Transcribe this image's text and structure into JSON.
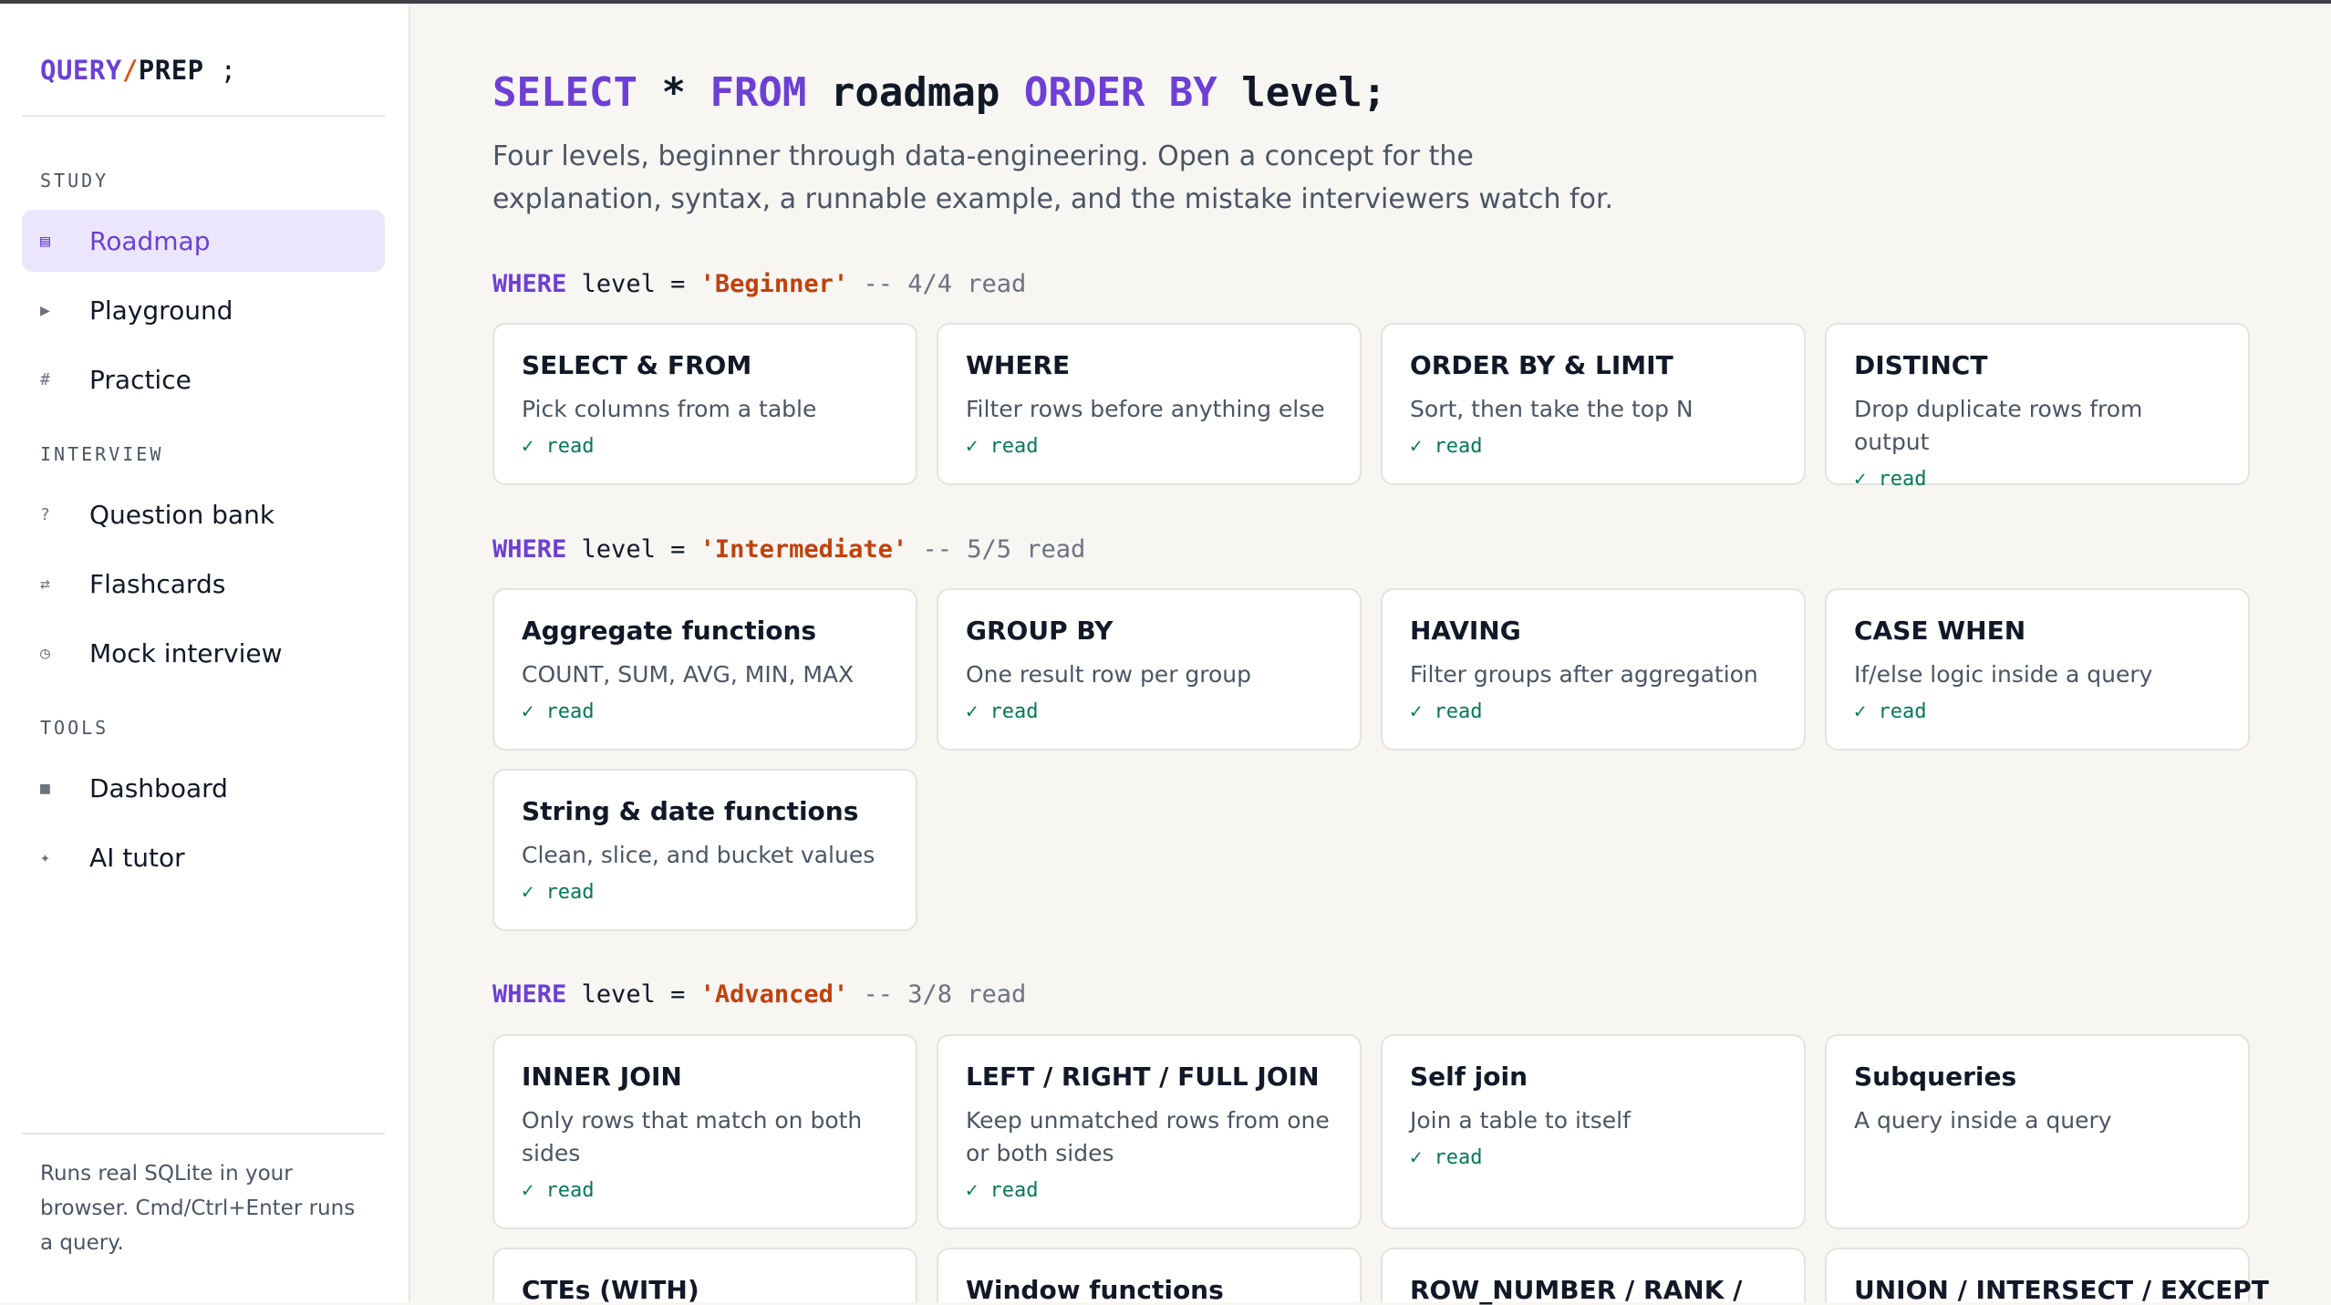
{
  "sidebar": {
    "logo": {
      "part1": "QUERY",
      "sep": "/",
      "part2": "PREP",
      "semi": ";"
    },
    "sections": [
      {
        "label": "STUDY",
        "items": [
          {
            "icon": "▤",
            "icon_name": "map-icon",
            "label": "Roadmap",
            "active": true
          },
          {
            "icon": "▶",
            "icon_name": "play-icon",
            "label": "Playground"
          },
          {
            "icon": "#",
            "icon_name": "hash-icon",
            "label": "Practice"
          }
        ]
      },
      {
        "label": "INTERVIEW",
        "items": [
          {
            "icon": "?",
            "icon_name": "question-icon",
            "label": "Question bank"
          },
          {
            "icon": "⇄",
            "icon_name": "swap-icon",
            "label": "Flashcards"
          },
          {
            "icon": "◷",
            "icon_name": "clock-icon",
            "label": "Mock interview"
          }
        ]
      },
      {
        "label": "TOOLS",
        "items": [
          {
            "icon": "■",
            "icon_name": "dashboard-icon",
            "label": "Dashboard"
          },
          {
            "icon": "✦",
            "icon_name": "sparkle-icon",
            "label": "AI tutor"
          }
        ]
      }
    ],
    "footer": "Runs real SQLite in your browser. Cmd/Ctrl+Enter runs a query."
  },
  "main": {
    "headline": {
      "kw1": "SELECT",
      "star": "*",
      "kw2": "FROM",
      "table": "roadmap",
      "kw3": "ORDER BY",
      "col": "level;"
    },
    "subtitle": "Four levels, beginner through data-engineering. Open a concept for the explanation, syntax, a runnable example, and the mistake interviewers watch for.",
    "levels": [
      {
        "where": "WHERE",
        "field": "level =",
        "value": "'Beginner'",
        "comment": "-- 4/4 read",
        "cards": [
          {
            "title": "SELECT & FROM",
            "desc": "Pick columns from a table",
            "status": "✓ read"
          },
          {
            "title": "WHERE",
            "desc": "Filter rows before anything else",
            "status": "✓ read"
          },
          {
            "title": "ORDER BY & LIMIT",
            "desc": "Sort, then take the top N",
            "status": "✓ read"
          },
          {
            "title": "DISTINCT",
            "desc": "Drop duplicate rows from output",
            "status": "✓ read"
          }
        ]
      },
      {
        "where": "WHERE",
        "field": "level =",
        "value": "'Intermediate'",
        "comment": "-- 5/5 read",
        "cards": [
          {
            "title": "Aggregate functions",
            "desc": "COUNT, SUM, AVG, MIN, MAX",
            "status": "✓ read"
          },
          {
            "title": "GROUP BY",
            "desc": "One result row per group",
            "status": "✓ read"
          },
          {
            "title": "HAVING",
            "desc": "Filter groups after aggregation",
            "status": "✓ read"
          },
          {
            "title": "CASE WHEN",
            "desc": "If/else logic inside a query",
            "status": "✓ read"
          },
          {
            "title": "String & date functions",
            "desc": "Clean, slice, and bucket values",
            "status": "✓ read"
          }
        ]
      },
      {
        "where": "WHERE",
        "field": "level =",
        "value": "'Advanced'",
        "comment": "-- 3/8 read",
        "cards": [
          {
            "title": "INNER JOIN",
            "desc": "Only rows that match on both sides",
            "status": "✓ read"
          },
          {
            "title": "LEFT / RIGHT / FULL JOIN",
            "desc": "Keep unmatched rows from one or both sides",
            "status": "✓ read"
          },
          {
            "title": "Self join",
            "desc": "Join a table to itself",
            "status": "✓ read"
          },
          {
            "title": "Subqueries",
            "desc": "A query inside a query",
            "status": ""
          },
          {
            "title": "CTEs (WITH)",
            "desc": "",
            "status": ""
          },
          {
            "title": "Window functions",
            "desc": "",
            "status": ""
          },
          {
            "title": "ROW_NUMBER / RANK /",
            "desc": "",
            "status": ""
          },
          {
            "title": "UNION / INTERSECT / EXCEPT",
            "desc": "",
            "status": ""
          }
        ]
      }
    ]
  }
}
